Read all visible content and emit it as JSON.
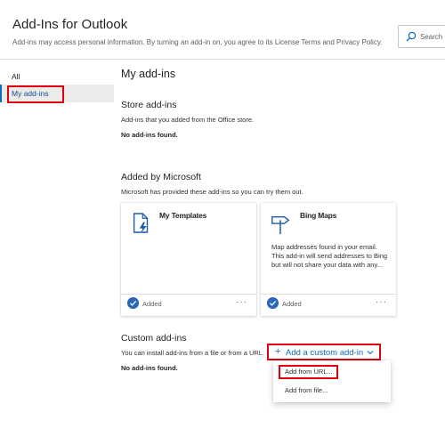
{
  "header": {
    "title": "Add-Ins for Outlook",
    "subtitle": "Add-ins may access personal information. By turning an add-in on, you agree to its License Terms and Privacy Policy.",
    "search_placeholder": "Search a"
  },
  "sidebar": {
    "items": [
      {
        "label": "All"
      },
      {
        "label": "My add-ins"
      }
    ]
  },
  "main": {
    "heading": "My add-ins",
    "store": {
      "heading": "Store add-ins",
      "description": "Add-ins that you added from the Office store.",
      "empty": "No add-ins found."
    },
    "microsoft": {
      "heading": "Added by Microsoft",
      "description": "Microsoft has provided these add-ins so you can try them out.",
      "cards": [
        {
          "title": "My Templates",
          "description": "",
          "status": "Added",
          "more": "···",
          "icon": "template-icon"
        },
        {
          "title": "Bing Maps",
          "description": "Map addresses found in your email. This add-in will send addresses to Bing but will not share your data with any...",
          "status": "Added",
          "more": "···",
          "icon": "signpost-icon"
        }
      ]
    },
    "custom": {
      "heading": "Custom add-ins",
      "description": "You can install add-ins from a file or from a URL.",
      "empty": "No add-ins found.",
      "add_button": "Add a custom add-in",
      "menu": [
        {
          "label": "Add from URL..."
        },
        {
          "label": "Add from file..."
        }
      ]
    }
  },
  "colors": {
    "accent": "#0f6cbd",
    "highlight_border": "#e0000f",
    "check_fill": "#2b66b8"
  }
}
